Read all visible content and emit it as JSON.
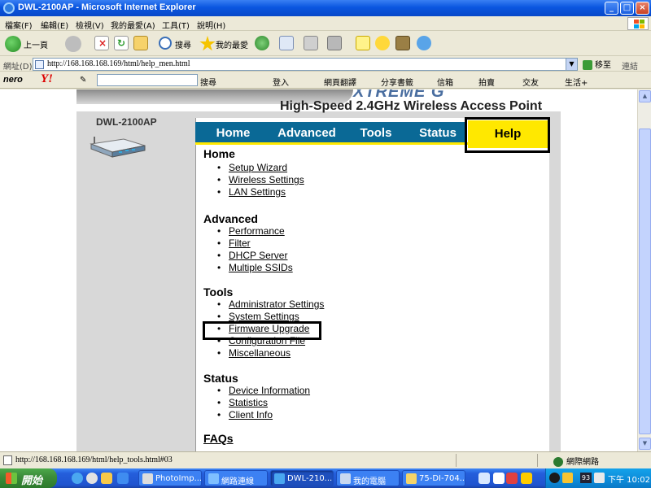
{
  "window": {
    "title": "DWL-2100AP - Microsoft Internet Explorer",
    "min": "_",
    "max": "□",
    "close": "×"
  },
  "menu": [
    "檔案(F)",
    "編輯(E)",
    "檢視(V)",
    "我的最愛(A)",
    "工具(T)",
    "說明(H)"
  ],
  "toolbar": {
    "back": "上一頁",
    "search": "搜尋",
    "favorites": "我的最愛"
  },
  "address": {
    "label": "網址(D)",
    "url": "http://168.168.168.169/html/help_men.html",
    "go": "移至",
    "links": "連結"
  },
  "extra": {
    "nero": "nero",
    "yahoo": "Y!",
    "search": "搜尋",
    "login": "登入",
    "translate": "網頁翻譯",
    "share": "分享書籤",
    "mail": "信箱",
    "auction": "拍賣",
    "dating": "交友",
    "life": "生活+"
  },
  "page": {
    "brand": "XTREME G",
    "subtitle": "High-Speed 2.4GHz Wireless Access Point",
    "model": "DWL-2100AP",
    "tabs": [
      "Home",
      "Advanced",
      "Tools",
      "Status",
      "Help"
    ],
    "sections": [
      {
        "title": "Home",
        "links": [
          "Setup Wizard",
          "Wireless Settings",
          "LAN Settings"
        ]
      },
      {
        "title": "Advanced",
        "links": [
          "Performance",
          "Filter",
          "DHCP Server",
          "Multiple SSIDs"
        ]
      },
      {
        "title": "Tools",
        "links": [
          "Administrator Settings",
          "System Settings",
          "Firmware Upgrade",
          "Configuration File",
          "Miscellaneous"
        ]
      },
      {
        "title": "Status",
        "links": [
          "Device Information",
          "Statistics",
          "Client Info"
        ]
      }
    ],
    "faqs": "FAQs"
  },
  "status": {
    "url": "http://168.168.168.169/html/help_tools.html#03",
    "zone": "網際網路"
  },
  "taskbar": {
    "start": "開始",
    "tasks": [
      "PhotoImp...",
      "網路連線",
      "DWL-210...",
      "我的電腦",
      "75-DI-704..."
    ],
    "badge": "93",
    "clock": "下午 10:02"
  },
  "colors": {
    "tab_blue": "#0a6996",
    "tab_yellow": "#ffe800",
    "titlebar": "#0a56e0"
  }
}
